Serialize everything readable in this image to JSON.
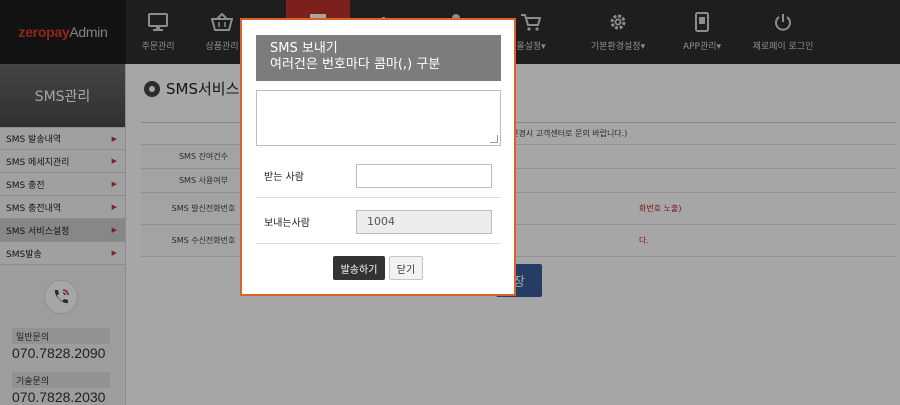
{
  "app": {
    "logo_left": "zeropay",
    "logo_right": " Admin"
  },
  "nav": {
    "items": [
      {
        "label": "주문관리",
        "icon": "monitor-icon"
      },
      {
        "label": "상품관리",
        "icon": "basket-icon"
      },
      {
        "label": "",
        "icon": "box-icon"
      },
      {
        "label": "",
        "icon": "chart-icon"
      },
      {
        "label": "",
        "icon": "user-icon"
      },
      {
        "label": "몰설정▾",
        "icon": "cart-icon"
      },
      {
        "label": "기본환경설정▾",
        "icon": "gear-icon"
      },
      {
        "label": "APP관리▾",
        "icon": "mobile-icon"
      },
      {
        "label": "제로페이 로그인",
        "icon": "power-icon"
      }
    ]
  },
  "sidebar": {
    "title": "SMS관리",
    "items": [
      {
        "label": "SMS 발송내역"
      },
      {
        "label": "SMS 메세지관리"
      },
      {
        "label": "SMS 충전"
      },
      {
        "label": "SMS 충전내역"
      },
      {
        "label": "SMS 서비스설정"
      },
      {
        "label": "SMS발송"
      }
    ],
    "cs_general_label": "일반문의",
    "cs_general_phone": "070.7828.2090",
    "cs_tech_label": "기술문의",
    "cs_tech_phone": "070.7828.2030"
  },
  "main": {
    "title": "SMS서비스",
    "note": "변경시 고객센터로 문의 바랍니다.)",
    "rows": [
      {
        "label": "SMS 잔여건수"
      },
      {
        "label": "SMS 사용여부"
      },
      {
        "label": "SMS 발신전화번호",
        "value": "화번호 노출)"
      },
      {
        "label": "SMS 수신전화번호",
        "value": "다."
      }
    ],
    "save_label": "장"
  },
  "modal": {
    "title_line1": "SMS 보내기",
    "title_line2": "여러건은 번호마다 콤마(,) 구분",
    "message_value": "",
    "receiver_label": "받는 사람",
    "receiver_value": "",
    "sender_label": "보내는사람",
    "sender_value": "1004",
    "send_label": "발송하기",
    "close_label": "닫기"
  },
  "colors": {
    "nav_bg": "#2e2e2e",
    "nav_active": "#c0302a",
    "modal_border": "#d9622a",
    "accent_red": "#d0322b",
    "save_blue": "#3a5c9c"
  }
}
